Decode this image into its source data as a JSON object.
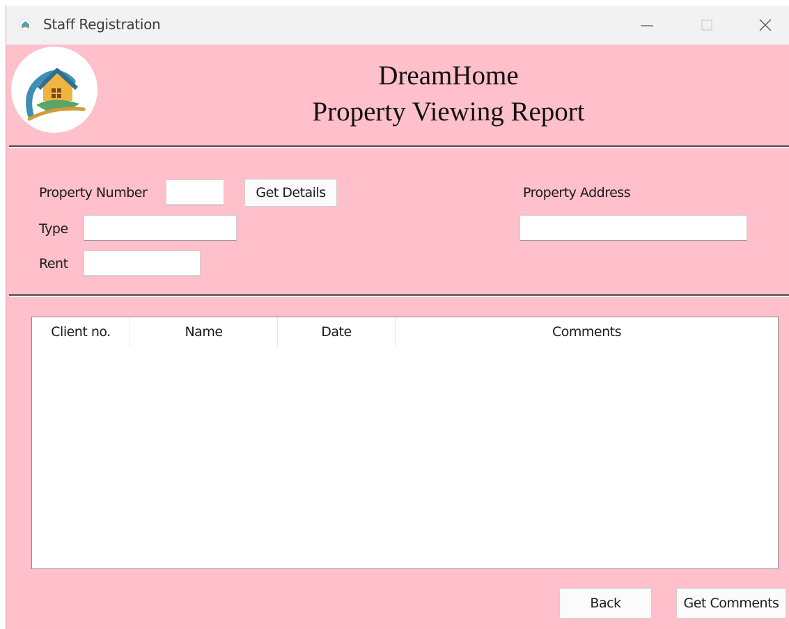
{
  "window": {
    "title": "Staff Registration",
    "icon": "dreamhome-app-icon",
    "controls": [
      "minimize-icon",
      "maximize-icon",
      "close-icon"
    ]
  },
  "header": {
    "logo": "dreamhome-logo",
    "title_line1": "DreamHome",
    "title_line2": "Property Viewing Report"
  },
  "form": {
    "property_number_label": "Property Number",
    "property_number_value": "",
    "get_details_label": "Get Details",
    "type_label": "Type",
    "type_value": "",
    "rent_label": "Rent",
    "rent_value": "",
    "property_address_label": "Property Address",
    "property_address_value": ""
  },
  "table": {
    "columns": [
      "Client no.",
      "Name",
      "Date",
      "Comments"
    ],
    "rows": []
  },
  "footer": {
    "back_label": "Back",
    "get_comments_label": "Get Comments"
  },
  "colors": {
    "background": "#ffbfcb",
    "titlebar": "#f2f2f2"
  }
}
